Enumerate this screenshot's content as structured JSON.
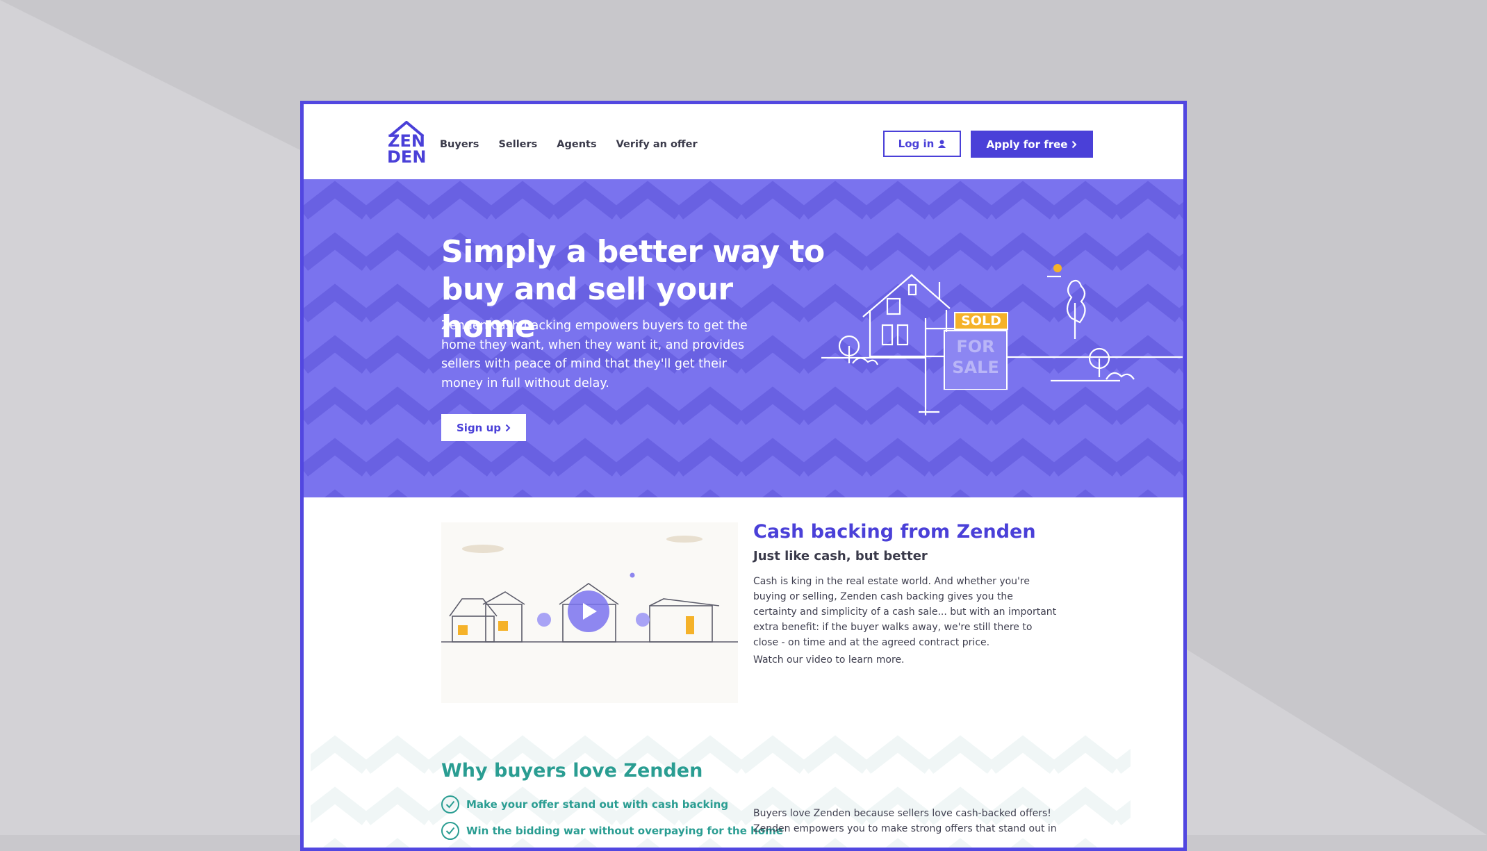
{
  "brand": {
    "logo_text_top": "ZEN",
    "logo_text_bottom": "DEN",
    "color": "#4a40d8"
  },
  "nav": {
    "items": [
      "Buyers",
      "Sellers",
      "Agents",
      "Verify an offer"
    ]
  },
  "header": {
    "login_label": "Log in",
    "apply_label": "Apply for free"
  },
  "hero": {
    "title": "Simply a better way to buy and sell your home",
    "description": "Zenden cash backing empowers buyers to get the home they want, when they want it, and provides sellers with peace of mind that they'll get their money in full without delay.",
    "signup_label": "Sign up",
    "sign_sold": "SOLD",
    "sign_for": "FOR",
    "sign_sale": "SALE",
    "bg_color": "#7a73ee"
  },
  "cash_backing": {
    "title": "Cash backing from Zenden",
    "subtitle": "Just like cash, but better",
    "paragraph": "Cash is king in the real estate world. And whether you're buying or selling, Zenden cash backing gives you the certainty and simplicity of a cash sale... but with an important extra benefit: if the buyer walks away, we're still there to close - on time and at the agreed contract price.",
    "watch": "Watch our video to learn more."
  },
  "why_buyers": {
    "title": "Why buyers love Zenden",
    "items": [
      "Make your offer stand out with cash backing",
      "Win the bidding war without overpaying for the home"
    ],
    "paragraph": "Buyers love Zenden because sellers love cash-backed offers! Zenden empowers you to make strong offers that stand out in",
    "accent": "#2a9d92"
  }
}
